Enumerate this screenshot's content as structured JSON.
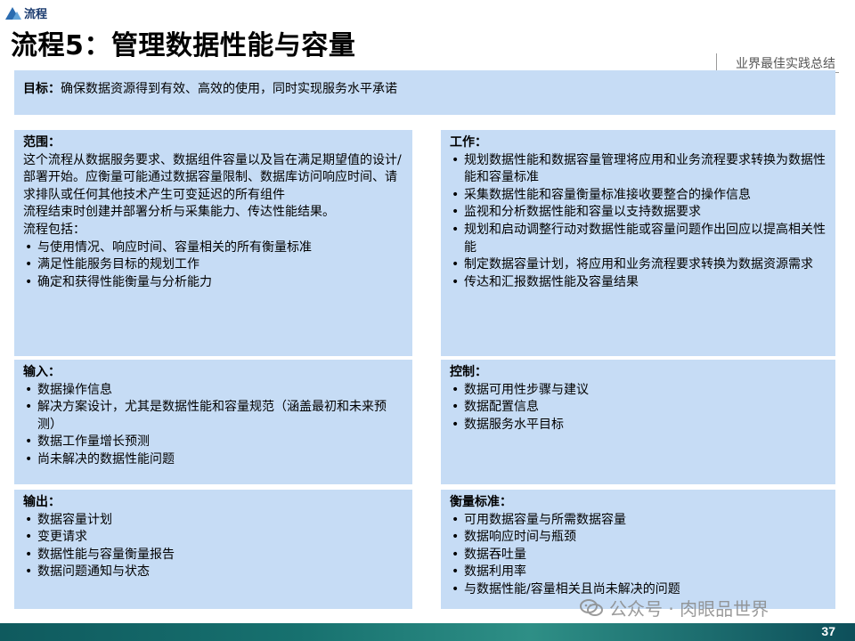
{
  "header": {
    "logo_text": "流程",
    "title": "流程5：管理数据性能与容量",
    "tag": "业界最佳实践总结"
  },
  "goal": {
    "label": "目标：",
    "text": "确保数据资源得到有效、高效的使用，同时实现服务水平承诺"
  },
  "scope": {
    "label": "范围：",
    "paragraphs": [
      "这个流程从数据服务要求、数据组件容量以及旨在满足期望值的设计/部署开始。应衡量可能通过数据容量限制、数据库访问响应时间、请求排队或任何其他技术产生可变延迟的所有组件",
      "流程结束时创建并部署分析与采集能力、传达性能结果。",
      "流程包括："
    ],
    "items": [
      "与使用情况、响应时间、容量相关的所有衡量标准",
      "满足性能服务目标的规划工作",
      "确定和获得性能衡量与分析能力"
    ]
  },
  "work": {
    "label": "工作：",
    "items": [
      "规划数据性能和数据容量管理将应用和业务流程要求转换为数据性能和容量标准",
      "采集数据性能和容量衡量标准接收要整合的操作信息",
      "监视和分析数据性能和容量以支持数据要求",
      "规划和启动调整行动对数据性能或容量问题作出回应以提高相关性能",
      "制定数据容量计划，将应用和业务流程要求转换为数据资源需求",
      "传达和汇报数据性能及容量结果"
    ]
  },
  "input": {
    "label": "输入：",
    "items": [
      "数据操作信息",
      "解决方案设计，尤其是数据性能和容量规范（涵盖最初和未来预测）",
      "数据工作量增长预测",
      "尚未解决的数据性能问题"
    ]
  },
  "control": {
    "label": "控制：",
    "items": [
      "数据可用性步骤与建议",
      "数据配置信息",
      "数据服务水平目标"
    ]
  },
  "output": {
    "label": "输出：",
    "items": [
      "数据容量计划",
      "变更请求",
      "数据性能与容量衡量报告",
      "数据问题通知与状态"
    ]
  },
  "metrics": {
    "label": "衡量标准：",
    "items": [
      "可用数据容量与所需数据容量",
      "数据响应时间与瓶颈",
      "数据吞吐量",
      "数据利用率",
      "与数据性能/容量相关且尚未解决的问题"
    ]
  },
  "watermark": "公众号 · 肉眼品世界",
  "page_number": "37"
}
